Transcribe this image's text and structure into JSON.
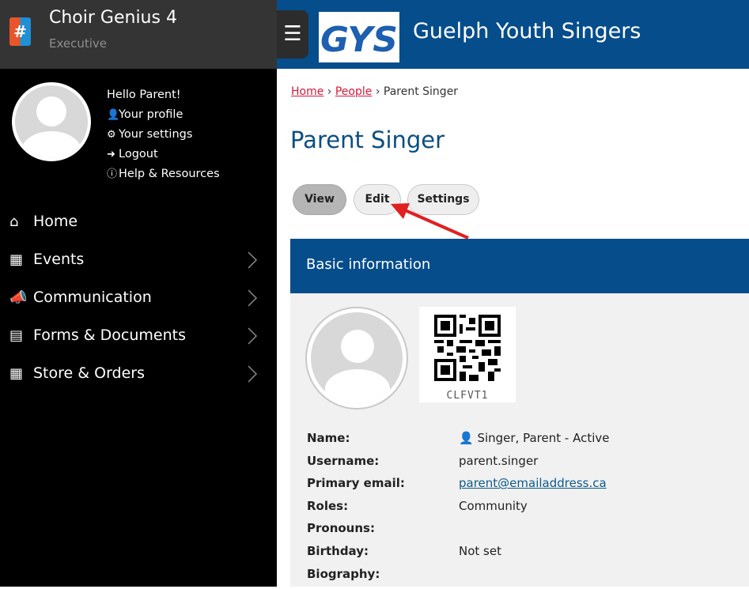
{
  "brand": {
    "title": "Choir Genius 4",
    "subtitle": "Executive",
    "logo_glyph": "#"
  },
  "user": {
    "greeting": "Hello Parent!",
    "links": [
      {
        "icon": "user-icon",
        "label": "Your profile"
      },
      {
        "icon": "gear-icon",
        "label": "Your settings"
      },
      {
        "icon": "logout-icon",
        "label": "Logout"
      },
      {
        "icon": "info-icon",
        "label": "Help & Resources"
      }
    ]
  },
  "nav": [
    {
      "icon": "home-icon",
      "label": "Home",
      "expandable": false
    },
    {
      "icon": "calendar-icon",
      "label": "Events",
      "expandable": true
    },
    {
      "icon": "megaphone-icon",
      "label": "Communication",
      "expandable": true
    },
    {
      "icon": "list-icon",
      "label": "Forms & Documents",
      "expandable": true
    },
    {
      "icon": "store-icon",
      "label": "Store & Orders",
      "expandable": true
    }
  ],
  "header": {
    "menu_icon": "hamburger-icon",
    "org_logo_text": "GYS",
    "org_name": "Guelph Youth Singers"
  },
  "breadcrumb": {
    "home": "Home",
    "sep1": "›",
    "people": "People",
    "sep2": "›",
    "current": "Parent Singer"
  },
  "page": {
    "title": "Parent Singer"
  },
  "tabs": [
    {
      "label": "View",
      "active": true
    },
    {
      "label": "Edit",
      "active": false
    },
    {
      "label": "Settings",
      "active": false
    }
  ],
  "card": {
    "header": "Basic information",
    "qr_text": "CLFVT1",
    "fields": [
      {
        "label": "Name:",
        "value": "Singer, Parent - Active",
        "icon": "user-icon"
      },
      {
        "label": "Username:",
        "value": "parent.singer"
      },
      {
        "label": "Primary email:",
        "value": "parent@emailaddress.ca",
        "link": true
      },
      {
        "label": "Roles:",
        "value": "Community"
      },
      {
        "label": "Pronouns:",
        "value": ""
      },
      {
        "label": "Birthday:",
        "value": "Not set"
      },
      {
        "label": "Biography:",
        "value": ""
      }
    ]
  },
  "colors": {
    "primary": "#064d8c",
    "sidebar": "#000000",
    "brand_bar": "#343434",
    "link": "#d11a3b",
    "arrow": "#e02020"
  }
}
